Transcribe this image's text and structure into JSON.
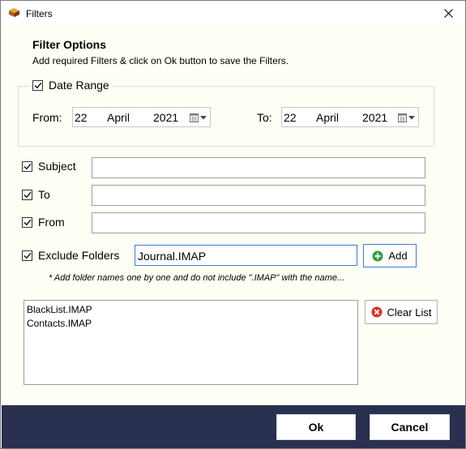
{
  "window": {
    "title": "Filters"
  },
  "header": {
    "title": "Filter Options",
    "subtitle": "Add required Filters & click on Ok button to save the Filters."
  },
  "date_range": {
    "label": "Date Range",
    "checked": true,
    "from": {
      "label": "From:",
      "day": "22",
      "month": "April",
      "year": "2021"
    },
    "to": {
      "label": "To:",
      "day": "22",
      "month": "April",
      "year": "2021"
    }
  },
  "filters": {
    "subject": {
      "label": "Subject",
      "checked": true,
      "value": ""
    },
    "to": {
      "label": "To",
      "checked": true,
      "value": ""
    },
    "from": {
      "label": "From",
      "checked": true,
      "value": ""
    }
  },
  "exclude_folders": {
    "label": "Exclude Folders",
    "checked": true,
    "input_value": "Journal.IMAP",
    "add_label": "Add",
    "hint": "* Add folder names one by one and do not include \".IMAP\" with the name...",
    "list": [
      "BlackList.IMAP",
      "Contacts.IMAP"
    ],
    "clear_label": "Clear List"
  },
  "footer": {
    "ok_label": "Ok",
    "cancel_label": "Cancel"
  },
  "colors": {
    "footer_bg": "#2a3050",
    "content_bg": "#fffff5",
    "focus_border": "#3c7bd6",
    "add_green": "#2ea043",
    "clear_red": "#d93025"
  }
}
